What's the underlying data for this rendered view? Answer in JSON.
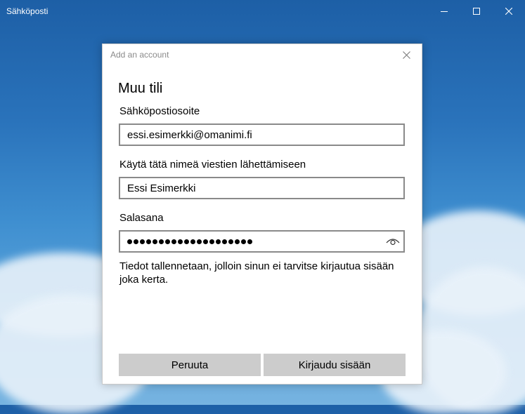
{
  "window": {
    "title": "Sähköposti",
    "controls": [
      "minimize-icon",
      "maximize-icon",
      "close-icon"
    ]
  },
  "dialog": {
    "title": "Add an account",
    "heading": "Muu tili",
    "email": {
      "label": "Sähköpostiosoite",
      "value": "essi.esimerkki@omanimi.fi"
    },
    "name": {
      "label": "Käytä tätä nimeä viestien lähettämiseen",
      "value": "Essi Esimerkki"
    },
    "password": {
      "label": "Salasana",
      "masked_length": 20,
      "reveal_icon": "eye-icon"
    },
    "info_text": "Tiedot tallennetaan, jolloin sinun ei tarvitse kirjautua sisään joka kerta.",
    "cancel_label": "Peruuta",
    "signin_label": "Kirjaudu sisään"
  }
}
